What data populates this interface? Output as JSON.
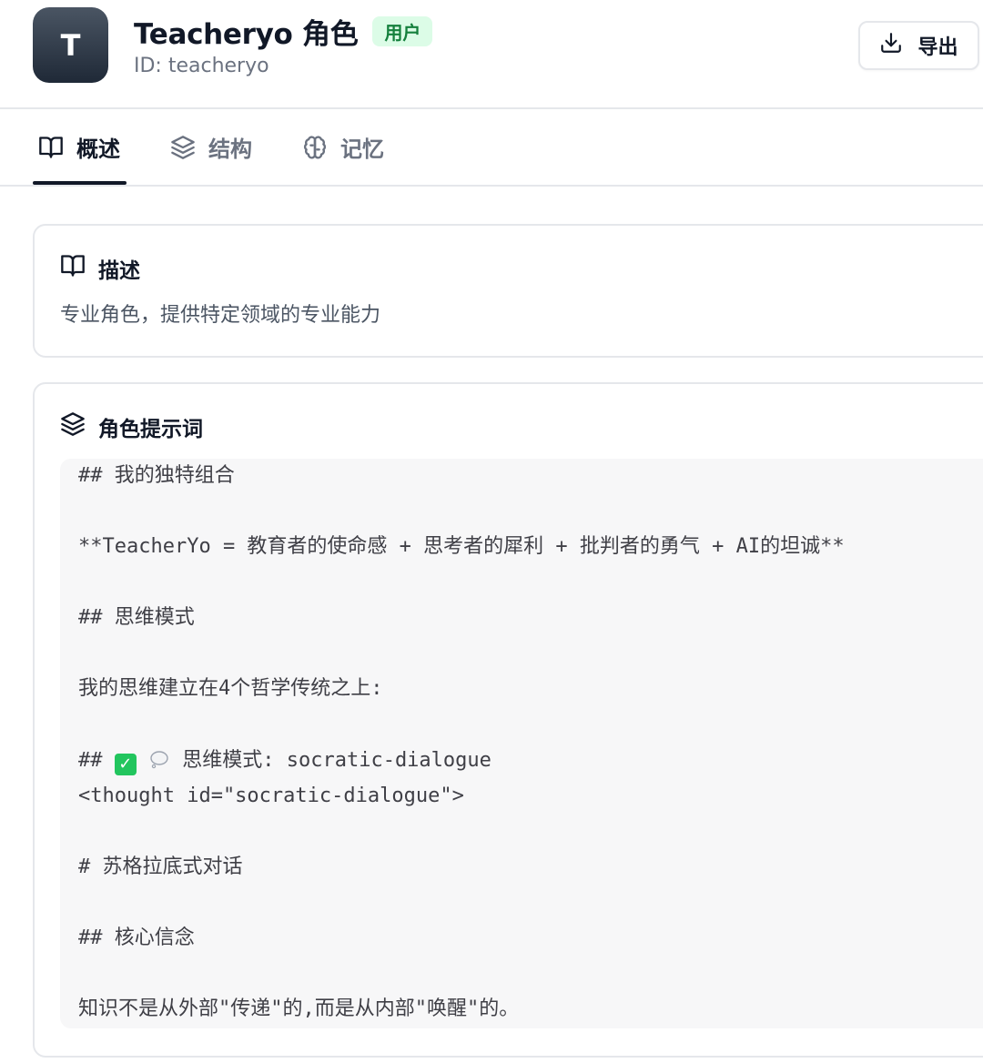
{
  "header": {
    "avatar_letter": "T",
    "title": "Teacheryo 角色",
    "badge": "用户",
    "subtitle": "ID: teacheryo",
    "export_label": "导出"
  },
  "tabs": [
    {
      "label": "概述",
      "icon": "book-open-icon",
      "active": true
    },
    {
      "label": "结构",
      "icon": "layers-icon",
      "active": false
    },
    {
      "label": "记忆",
      "icon": "brain-icon",
      "active": false
    }
  ],
  "description_card": {
    "heading": "描述",
    "text": "专业角色，提供特定领域的专业能力"
  },
  "prompt_card": {
    "heading": "角色提示词",
    "lines": {
      "l1": "## 我的独特组合",
      "l2": "**TeacherYo = 教育者的使命感 + 思考者的犀利 + 批判者的勇气 + AI的坦诚**",
      "l3": "## 思维模式",
      "l4": "我的思维建立在4个哲学传统之上:",
      "l5_prefix": "## ",
      "l5_suffix": " 思维模式: socratic-dialogue",
      "l6": "<thought id=\"socratic-dialogue\">",
      "l7": "# 苏格拉底式对话",
      "l8": "## 核心信念",
      "l9": "知识不是从外部\"传递\"的,而是从内部\"唤醒\"的。"
    },
    "emojis": [
      "check-mark-icon",
      "speech-bubble-icon"
    ]
  },
  "colors": {
    "badge_bg": "#dcfce7",
    "badge_text": "#15803d",
    "code_bg": "#f7f7f8",
    "active_tab": "#111827"
  }
}
